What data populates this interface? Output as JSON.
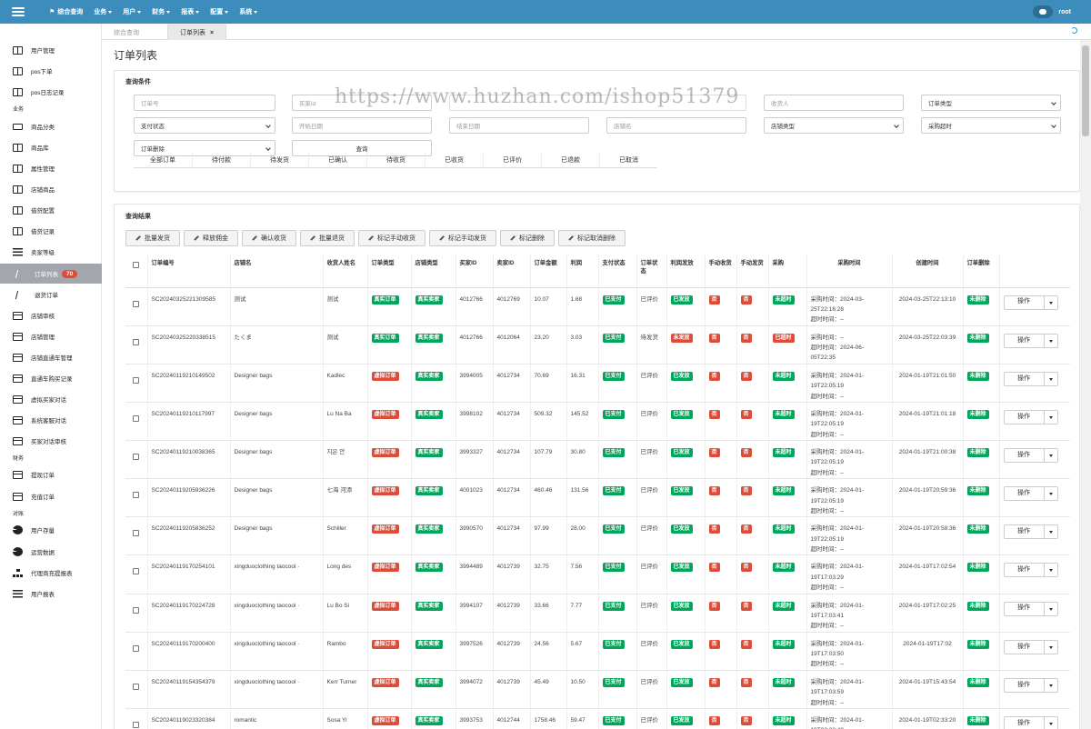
{
  "topnav": {
    "home": "综合查询",
    "menus": [
      "业务",
      "用户",
      "财务",
      "报表",
      "配置",
      "系统"
    ],
    "user": "root"
  },
  "sidebar": {
    "items": [
      {
        "label": "用户管理",
        "icon": "book-icon"
      },
      {
        "label": "pos下单",
        "icon": "book-icon"
      },
      {
        "label": "pos日志记录",
        "icon": "book-icon"
      }
    ],
    "section_business": "业务",
    "business_items": [
      {
        "label": "商品分类",
        "icon": "laptop-icon"
      },
      {
        "label": "商品库",
        "icon": "book-icon"
      },
      {
        "label": "属性管理",
        "icon": "book-icon"
      },
      {
        "label": "店铺商品",
        "icon": "book-icon"
      },
      {
        "label": "借贷配置",
        "icon": "book-icon"
      },
      {
        "label": "借贷记录",
        "icon": "book-icon"
      },
      {
        "label": "卖家等级",
        "icon": "list-icon"
      },
      {
        "label": "订单列表",
        "icon": "slash-icon",
        "badge": "70",
        "active": true
      },
      {
        "label": "退货订单",
        "icon": "slash-icon"
      },
      {
        "label": "店铺审核",
        "icon": "card-icon"
      },
      {
        "label": "店铺管理",
        "icon": "card-icon"
      },
      {
        "label": "店铺直通车管理",
        "icon": "card-icon"
      },
      {
        "label": "直通车购买记录",
        "icon": "card-icon"
      },
      {
        "label": "虚拟买家对话",
        "icon": "card-icon"
      },
      {
        "label": "系统客服对话",
        "icon": "card-icon"
      },
      {
        "label": "买家对话审核",
        "icon": "card-icon"
      }
    ],
    "section_finance": "财务",
    "finance_items": [
      {
        "label": "提现订单",
        "icon": "card-icon"
      },
      {
        "label": "充值订单",
        "icon": "card-icon"
      }
    ],
    "section_report": "对账",
    "report_items": [
      {
        "label": "用户存量",
        "icon": "pie-icon"
      },
      {
        "label": "运营数据",
        "icon": "pie-icon"
      },
      {
        "label": "代理商充提报表",
        "icon": "sitemap-icon"
      },
      {
        "label": "用户报表",
        "icon": "list-icon"
      }
    ]
  },
  "tabs": [
    {
      "label": "综合查询"
    },
    {
      "label": "订单列表",
      "close": "×"
    }
  ],
  "page_title": "订单列表",
  "query": {
    "title": "查询条件",
    "order_no": "订单号",
    "buyer_id": "买家id",
    "receiver": "收货人",
    "order_type": "订单类型",
    "pay_status": "支付状态",
    "start_date": "开始日期",
    "end_date": "结束日期",
    "store_name": "店铺名",
    "store_type": "店铺类型",
    "purchase_timeout": "采购超时",
    "order_deleted": "订单删除",
    "submit": "查询"
  },
  "status_tabs": [
    "全部订单",
    "待付款",
    "待发货",
    "已确认",
    "待收货",
    "已收货",
    "已评价",
    "已退款",
    "已取消"
  ],
  "results": {
    "title": "查询结果",
    "actions": [
      "批量发货",
      "释放佣金",
      "确认收货",
      "批量退货",
      "标记手动收货",
      "标记手动发货",
      "标记删除",
      "标记取消删除"
    ],
    "columns": [
      "订单编号",
      "店铺名",
      "收货人姓名",
      "订单类型",
      "店铺类型",
      "买家ID",
      "卖家ID",
      "订单金额",
      "利润",
      "支付状态",
      "订单状态",
      "利润发放",
      "手动收货",
      "手动发货",
      "采购",
      "采购时间",
      "创建时间",
      "订单删除",
      ""
    ],
    "op_label": "操作",
    "rows": [
      {
        "no": "SC20240325221309585",
        "store": "测试",
        "receiver": "测试",
        "otype": "真实订单",
        "otype_c": "g",
        "stype": "真实卖家",
        "buyer": "4012766",
        "seller": "4012769",
        "amount": "10.07",
        "profit": "1.68",
        "pay": "已支付",
        "status": "已评价",
        "release": "已发放",
        "release_c": "g",
        "mrecv": "否",
        "msend": "否",
        "purchase": "未超时",
        "purchase_c": "g",
        "ptime": "采购时间：2024-03-25T22:16:28",
        "timeout": "超时时间：--",
        "created": "2024-03-25T22:13:10",
        "deleted": "未删除"
      },
      {
        "no": "SC20240325220338515",
        "store": "たくま",
        "receiver": "测试",
        "otype": "真实订单",
        "otype_c": "g",
        "stype": "真实卖家",
        "buyer": "4012766",
        "seller": "4012064",
        "amount": "23.20",
        "profit": "3.03",
        "pay": "已支付",
        "status": "待发货",
        "release": "未发放",
        "release_c": "r",
        "mrecv": "否",
        "msend": "否",
        "purchase": "已超时",
        "purchase_c": "r",
        "ptime": "采购时间：--",
        "timeout": "超时时间：2024-06-05T22:35",
        "created": "2024-03-25T22:03:39",
        "deleted": "未删除"
      },
      {
        "no": "SC20240119210149502",
        "store": "Designer bags",
        "receiver": "Kadlec",
        "otype": "虚拟订单",
        "otype_c": "r",
        "stype": "真实卖家",
        "buyer": "3994005",
        "seller": "4012734",
        "amount": "70.69",
        "profit": "16.31",
        "pay": "已支付",
        "status": "已评价",
        "release": "已发放",
        "release_c": "g",
        "mrecv": "否",
        "msend": "否",
        "purchase": "未超时",
        "purchase_c": "g",
        "ptime": "采购时间：2024-01-19T22:05:19",
        "timeout": "超时时间：--",
        "created": "2024-01-19T21:01:50",
        "deleted": "未删除"
      },
      {
        "no": "SC20240119210117997",
        "store": "Designer bags",
        "receiver": "Lu Na Ba",
        "otype": "虚拟订单",
        "otype_c": "r",
        "stype": "真实卖家",
        "buyer": "3998102",
        "seller": "4012734",
        "amount": "509.32",
        "profit": "145.52",
        "pay": "已支付",
        "status": "已评价",
        "release": "已发放",
        "release_c": "g",
        "mrecv": "否",
        "msend": "否",
        "purchase": "未超时",
        "purchase_c": "g",
        "ptime": "采购时间：2024-01-19T22:05:19",
        "timeout": "超时时间：--",
        "created": "2024-01-19T21:01:18",
        "deleted": "未删除"
      },
      {
        "no": "SC20240119210038365",
        "store": "Designer bags",
        "receiver": "지은 안",
        "otype": "虚拟订单",
        "otype_c": "r",
        "stype": "真实卖家",
        "buyer": "3993327",
        "seller": "4012734",
        "amount": "107.79",
        "profit": "30.80",
        "pay": "已支付",
        "status": "已评价",
        "release": "已发放",
        "release_c": "g",
        "mrecv": "否",
        "msend": "否",
        "purchase": "未超时",
        "purchase_c": "g",
        "ptime": "采购时间：2024-01-19T22:05:19",
        "timeout": "超时时间：--",
        "created": "2024-01-19T21:00:38",
        "deleted": "未删除"
      },
      {
        "no": "SC20240119205936226",
        "store": "Designer bags",
        "receiver": "七海 河添",
        "otype": "虚拟订单",
        "otype_c": "r",
        "stype": "真实卖家",
        "buyer": "4001023",
        "seller": "4012734",
        "amount": "460.46",
        "profit": "131.56",
        "pay": "已支付",
        "status": "已评价",
        "release": "已发放",
        "release_c": "g",
        "mrecv": "否",
        "msend": "否",
        "purchase": "未超时",
        "purchase_c": "g",
        "ptime": "采购时间：2024-01-19T22:05:19",
        "timeout": "超时时间：--",
        "created": "2024-01-19T20:59:36",
        "deleted": "未删除"
      },
      {
        "no": "SC20240119205836252",
        "store": "Designer bags",
        "receiver": "Schiller",
        "otype": "虚拟订单",
        "otype_c": "r",
        "stype": "真实卖家",
        "buyer": "3990570",
        "seller": "4012734",
        "amount": "97.99",
        "profit": "28.00",
        "pay": "已支付",
        "status": "已评价",
        "release": "已发放",
        "release_c": "g",
        "mrecv": "否",
        "msend": "否",
        "purchase": "未超时",
        "purchase_c": "g",
        "ptime": "采购时间：2024-01-19T22:05:19",
        "timeout": "超时时间：--",
        "created": "2024-01-19T20:58:36",
        "deleted": "未删除"
      },
      {
        "no": "SC20240119170254101",
        "store": "xingduoclothing taocool ·",
        "receiver": "Long des",
        "otype": "虚拟订单",
        "otype_c": "r",
        "stype": "真实卖家",
        "buyer": "3994489",
        "seller": "4012739",
        "amount": "32.75",
        "profit": "7.56",
        "pay": "已支付",
        "status": "已评价",
        "release": "已发放",
        "release_c": "g",
        "mrecv": "否",
        "msend": "否",
        "purchase": "未超时",
        "purchase_c": "g",
        "ptime": "采购时间：2024-01-19T17:03:29",
        "timeout": "超时时间：--",
        "created": "2024-01-19T17:02:54",
        "deleted": "未删除"
      },
      {
        "no": "SC20240119170224728",
        "store": "xingduoclothing taocool ·",
        "receiver": "Lu Bo Si",
        "otype": "虚拟订单",
        "otype_c": "r",
        "stype": "真实卖家",
        "buyer": "3994107",
        "seller": "4012739",
        "amount": "33.66",
        "profit": "7.77",
        "pay": "已支付",
        "status": "已评价",
        "release": "已发放",
        "release_c": "g",
        "mrecv": "否",
        "msend": "否",
        "purchase": "未超时",
        "purchase_c": "g",
        "ptime": "采购时间：2024-01-19T17:03:41",
        "timeout": "超时时间：--",
        "created": "2024-01-19T17:02:25",
        "deleted": "未删除"
      },
      {
        "no": "SC20240119170200400",
        "store": "xingduoclothing taocool ·",
        "receiver": "Rambo",
        "otype": "虚拟订单",
        "otype_c": "r",
        "stype": "真实卖家",
        "buyer": "3997526",
        "seller": "4012739",
        "amount": "24.56",
        "profit": "5.67",
        "pay": "已支付",
        "status": "已评价",
        "release": "已发放",
        "release_c": "g",
        "mrecv": "否",
        "msend": "否",
        "purchase": "未超时",
        "purchase_c": "g",
        "ptime": "采购时间：2024-01-19T17:03:50",
        "timeout": "超时时间：--",
        "created": "2024-01-19T17:02",
        "deleted": "未删除"
      },
      {
        "no": "SC20240119154354379",
        "store": "xingduoclothing taocool ·",
        "receiver": "Kerr Turner",
        "otype": "虚拟订单",
        "otype_c": "r",
        "stype": "真实卖家",
        "buyer": "3994072",
        "seller": "4012739",
        "amount": "45.49",
        "profit": "10.50",
        "pay": "已支付",
        "status": "已评价",
        "release": "已发放",
        "release_c": "g",
        "mrecv": "否",
        "msend": "否",
        "purchase": "未超时",
        "purchase_c": "g",
        "ptime": "采购时间：2024-01-19T17:03:59",
        "timeout": "超时时间：--",
        "created": "2024-01-19T15:43:54",
        "deleted": "未删除"
      },
      {
        "no": "SC20240119023320384",
        "store": "romantic",
        "receiver": "Sosa Yi",
        "otype": "虚拟订单",
        "otype_c": "r",
        "stype": "真实卖家",
        "buyer": "3993753",
        "seller": "4012744",
        "amount": "1758.46",
        "profit": "59.47",
        "pay": "已支付",
        "status": "已评价",
        "release": "已发放",
        "release_c": "g",
        "mrecv": "否",
        "msend": "否",
        "purchase": "未超时",
        "purchase_c": "g",
        "ptime": "采购时间：2024-01-19T02:33:49",
        "timeout": "",
        "created": "2024-01-19T02:33:20",
        "deleted": "未删除"
      }
    ]
  },
  "watermark": "https://www.huzhan.com/ishop51379",
  "colors": {
    "topbar": "#3c8dbc",
    "success": "#00a65a",
    "danger": "#dd4b39",
    "active_sidebar": "#a3a7ad"
  }
}
